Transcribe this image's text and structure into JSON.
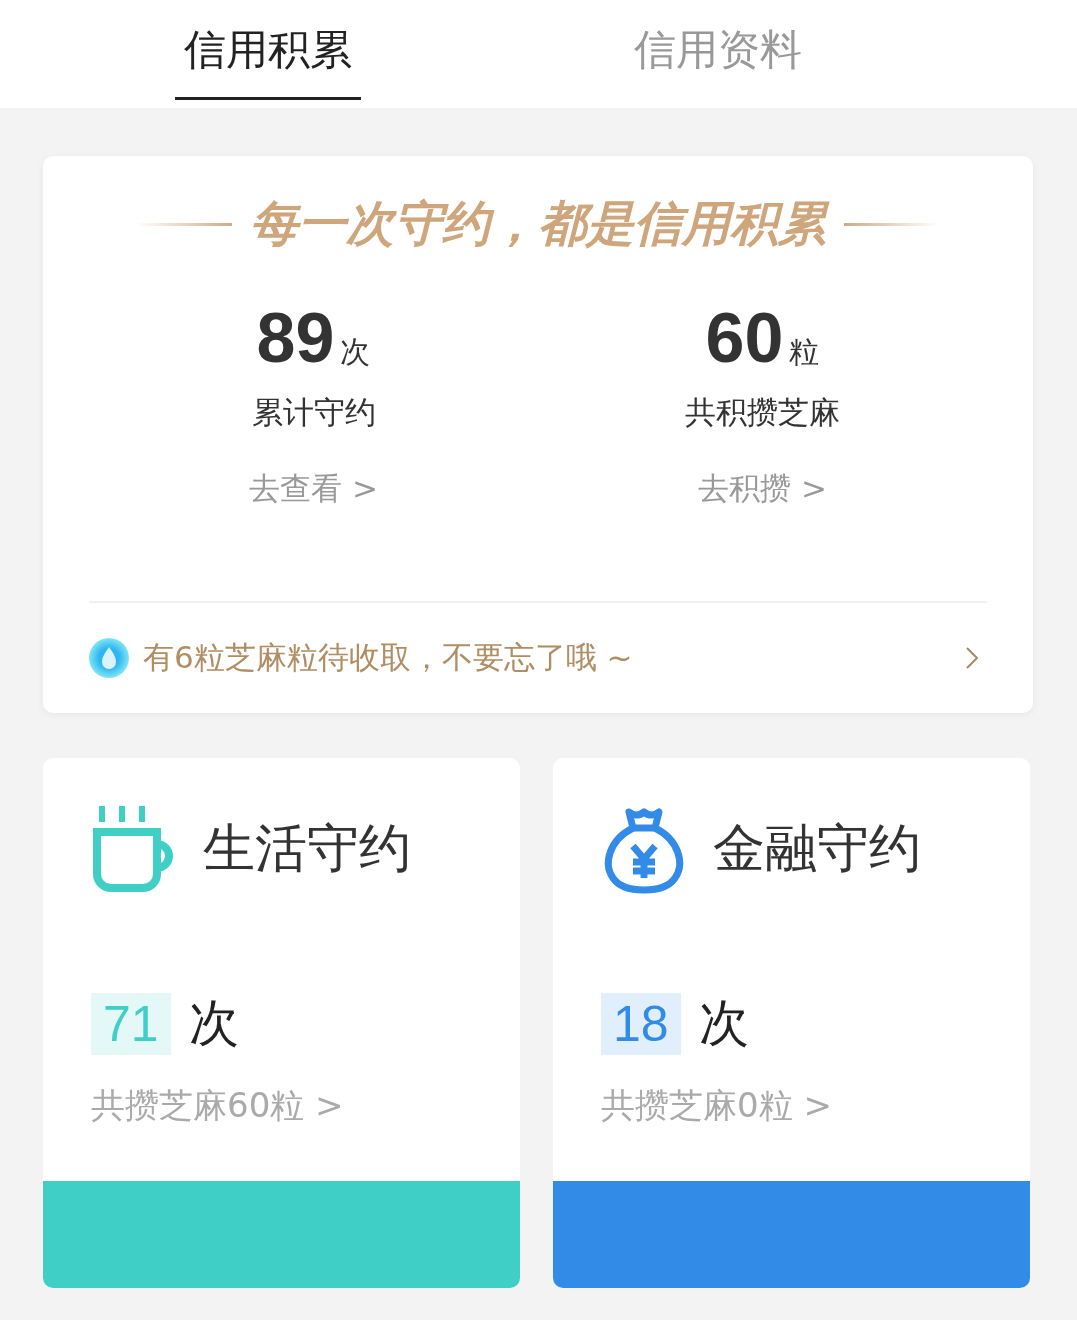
{
  "tabs": [
    {
      "label": "信用积累",
      "selected": true
    },
    {
      "label": "信用资料",
      "selected": false
    }
  ],
  "summary": {
    "slogan": "每一次守约，都是信用积累",
    "stats": [
      {
        "value": "89",
        "unit": "次",
        "label": "累计守约",
        "link": "去查看 >"
      },
      {
        "value": "60",
        "unit": "粒",
        "label": "共积攒芝麻",
        "link": "去积攒 >"
      }
    ],
    "notice": "有6粒芝麻粒待收取，不要忘了哦 ~"
  },
  "categories": [
    {
      "kind": "life",
      "title": "生活守约",
      "count": "71",
      "unit": "次",
      "link": "共攒芝麻60粒 >",
      "color": "#40cfc6"
    },
    {
      "kind": "finance",
      "title": "金融守约",
      "count": "18",
      "unit": "次",
      "link": "共攒芝麻0粒 >",
      "color": "#338be8"
    }
  ]
}
